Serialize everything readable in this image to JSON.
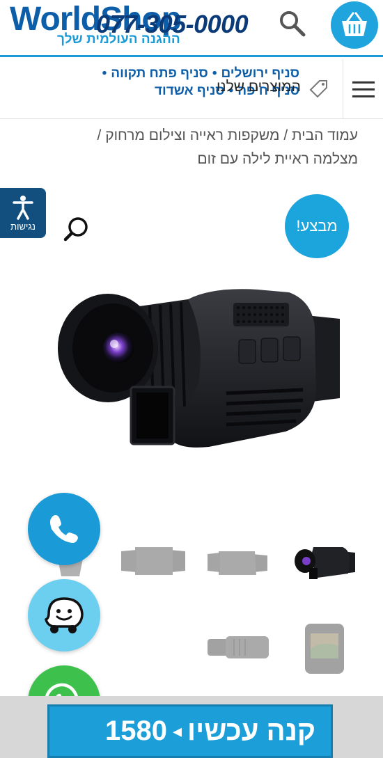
{
  "header": {
    "logo": "WorldShop",
    "tagline": "ההגנה העולמית שלך",
    "phone": "077-305-0000"
  },
  "nav": {
    "branches": [
      "סניף ירושלים",
      "סניף פתח תקווה",
      "סניף חיפה",
      "סניף אשדוד"
    ],
    "products_label": "המוצרים שלנו"
  },
  "breadcrumb": {
    "home": "עמוד הבית",
    "category": "משקפות ראייה וצילום מרחוק",
    "current": "מצלמה ראיית לילה עם זום",
    "separator": "/"
  },
  "accessibility": {
    "label": "נגישות"
  },
  "sale_badge": "מבצע!",
  "buy": {
    "label": "קנה עכשיו",
    "arrow": "◂",
    "price": "1580"
  },
  "icons": {
    "search": "search-icon",
    "cart": "basket-icon",
    "menu": "hamburger-icon",
    "tag": "tag-icon",
    "accessibility": "accessibility-icon",
    "zoom": "magnifier-icon",
    "phone": "phone-icon",
    "waze": "waze-icon",
    "whatsapp": "whatsapp-icon"
  },
  "colors": {
    "brand_blue": "#0d5ea8",
    "accent": "#1ca4dc",
    "whatsapp": "#3ec04c",
    "access_bg": "#124f7f"
  }
}
